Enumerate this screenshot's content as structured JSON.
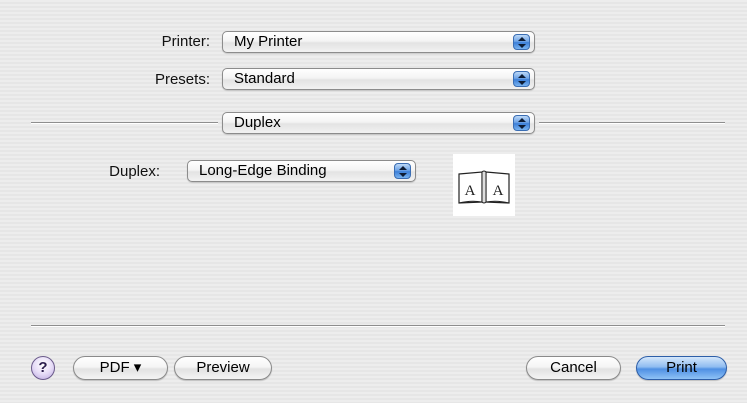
{
  "printer": {
    "label": "Printer:",
    "value": "My Printer"
  },
  "presets": {
    "label": "Presets:",
    "value": "Standard"
  },
  "panel": {
    "value": "Duplex"
  },
  "duplex": {
    "label": "Duplex:",
    "value": "Long-Edge Binding"
  },
  "buttons": {
    "help": "?",
    "pdf": "PDF ▾",
    "preview": "Preview",
    "cancel": "Cancel",
    "print": "Print"
  },
  "binding_icon": {
    "name": "long-edge-binding-book-icon",
    "glyph": "A"
  }
}
